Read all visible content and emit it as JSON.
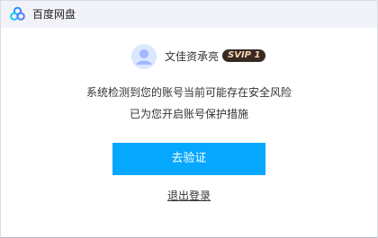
{
  "app": {
    "title": "百度网盘",
    "logo_icon": "baidu-netdisk-cloud-icon"
  },
  "user": {
    "name": "文佳资承亮",
    "badge": "SVIP 1",
    "avatar_icon": "default-user-avatar-icon"
  },
  "message": {
    "line1": "系统检测到您的账号当前可能存在安全风险",
    "line2": "已为您开启账号保护措施"
  },
  "actions": {
    "verify_label": "去验证",
    "logout_label": "退出登录"
  },
  "colors": {
    "accent": "#06a7ff",
    "titlebar_bg": "#f1f3f8",
    "vip_badge_bg": "#3a2a24",
    "vip_badge_text": "#f1d3b2"
  }
}
